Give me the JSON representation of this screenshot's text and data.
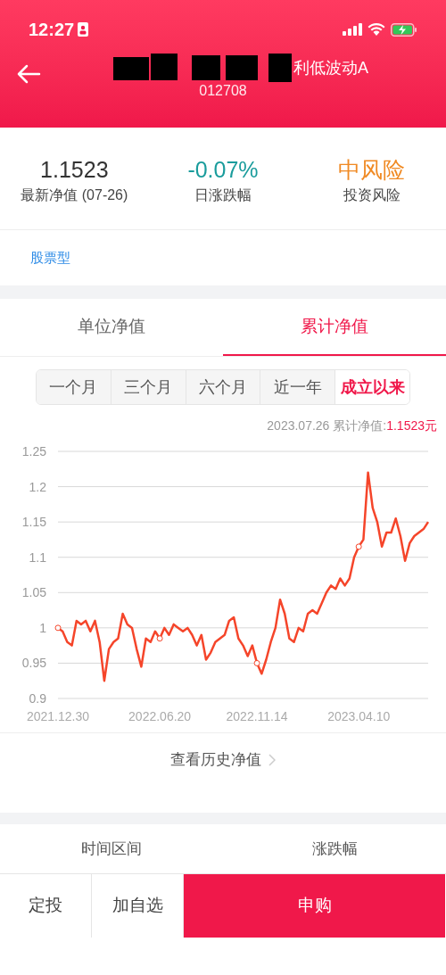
{
  "status_bar": {
    "time": "12:27"
  },
  "header": {
    "title": "利低波动A",
    "code": "012708"
  },
  "stats": [
    {
      "value": "1.1523",
      "label": "最新净值 (07-26)",
      "kind": "nav"
    },
    {
      "value": "-0.07%",
      "label": "日涨跌幅",
      "kind": "change"
    },
    {
      "value": "中风险",
      "label": "投资风险",
      "kind": "risk"
    }
  ],
  "fund_type": "股票型",
  "nav_tabs": [
    {
      "label": "单位净值",
      "selected": false
    },
    {
      "label": "累计净值",
      "selected": true
    }
  ],
  "periods": [
    {
      "label": "一个月",
      "selected": false
    },
    {
      "label": "三个月",
      "selected": false
    },
    {
      "label": "六个月",
      "selected": false
    },
    {
      "label": "近一年",
      "selected": false
    },
    {
      "label": "成立以来",
      "selected": true
    }
  ],
  "caption": {
    "label": "2023.07.26 累计净值:",
    "value": "1.1523元"
  },
  "chart_data": {
    "type": "line",
    "ylim": [
      0.9,
      1.25
    ],
    "yticks": [
      0.9,
      0.95,
      1,
      1.05,
      1.1,
      1.15,
      1.2,
      1.25
    ],
    "grid": true,
    "categories": [
      "2021.12.30",
      null,
      null,
      null,
      null,
      null,
      null,
      null,
      null,
      null,
      null,
      null,
      null,
      null,
      null,
      null,
      null,
      null,
      null,
      null,
      null,
      null,
      "2022.06.20",
      null,
      null,
      null,
      null,
      null,
      null,
      null,
      null,
      null,
      null,
      null,
      null,
      null,
      null,
      null,
      null,
      null,
      null,
      null,
      null,
      "2022.11.14",
      null,
      null,
      null,
      null,
      null,
      null,
      null,
      null,
      null,
      null,
      null,
      null,
      null,
      null,
      null,
      null,
      null,
      null,
      null,
      null,
      null,
      "2023.04.10",
      null,
      null,
      null,
      null,
      null,
      null,
      null,
      null,
      null,
      null,
      null,
      null,
      null,
      null,
      null
    ],
    "series": [
      {
        "color": "#f5452a",
        "values": [
          1.0,
          0.995,
          0.98,
          0.975,
          1.01,
          1.005,
          1.01,
          0.995,
          1.01,
          0.98,
          0.925,
          0.97,
          0.98,
          0.985,
          1.02,
          1.005,
          1.0,
          0.97,
          0.945,
          0.985,
          0.98,
          0.995,
          0.985,
          1.0,
          0.99,
          1.005,
          1.0,
          0.995,
          1.0,
          0.99,
          0.975,
          0.99,
          0.955,
          0.965,
          0.98,
          0.985,
          0.99,
          1.01,
          1.015,
          0.985,
          0.975,
          0.96,
          0.975,
          0.95,
          0.935,
          0.955,
          0.98,
          1.0,
          1.04,
          1.02,
          0.985,
          0.98,
          1.0,
          0.995,
          1.02,
          1.025,
          1.02,
          1.035,
          1.05,
          1.06,
          1.055,
          1.07,
          1.06,
          1.07,
          1.1,
          1.115,
          1.125,
          1.22,
          1.17,
          1.15,
          1.115,
          1.135,
          1.135,
          1.155,
          1.13,
          1.095,
          1.12,
          1.13,
          1.135,
          1.14,
          1.15
        ]
      }
    ]
  },
  "history_link": "查看历史净值",
  "table_header": [
    "时间区间",
    "涨跌幅"
  ],
  "actions": [
    {
      "label": "定投",
      "kind": "secondary"
    },
    {
      "label": "加自选",
      "kind": "secondary"
    },
    {
      "label": "申购",
      "kind": "primary"
    }
  ]
}
